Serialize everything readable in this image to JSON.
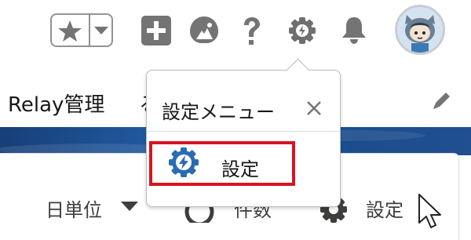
{
  "header": {
    "favorites_button": "favorites-button",
    "icons": [
      "plus-square-icon",
      "trailhead-icon",
      "help-icon",
      "gear-icon",
      "bell-icon"
    ]
  },
  "subheader": {
    "app_title": "Relay管理",
    "partial_text": "る"
  },
  "card": {
    "period_label": "日単位",
    "count_label": "件数",
    "settings_label": "設定"
  },
  "settings_menu": {
    "title": "設定メニュー",
    "close_glyph": "×",
    "items": [
      {
        "label": "設定",
        "icon": "setup-bolt-gear-icon"
      }
    ]
  },
  "colors": {
    "highlight": "#d7141f",
    "band": "#1c4f91",
    "icon_gray": "#747474",
    "setup_blue": "#2a6cb3"
  }
}
